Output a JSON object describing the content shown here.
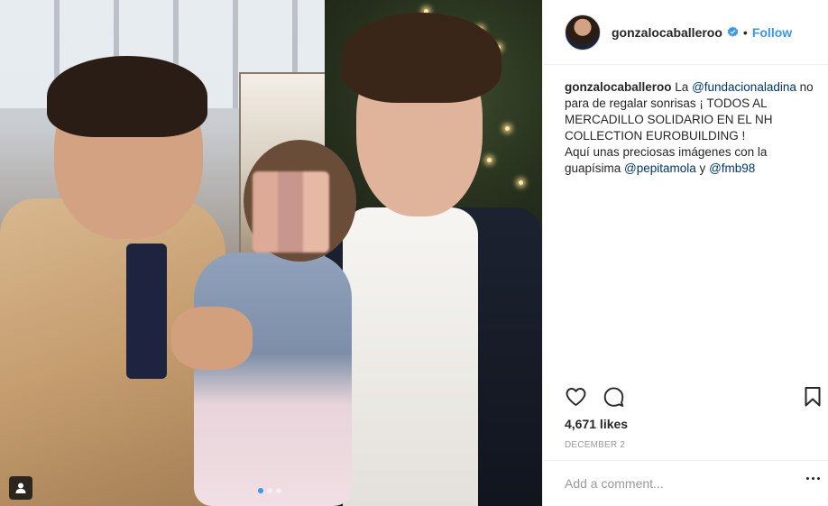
{
  "post": {
    "username": "gonzalocaballeroo",
    "follow_label": "Follow",
    "bullet": "•",
    "caption": {
      "username": "gonzalocaballeroo",
      "part1": " La ",
      "mention1": "@fundacionaladina",
      "part2": " no para de regalar sonrisas ¡ TODOS AL MERCADILLO SOLIDARIO EN EL NH COLLECTION EUROBUILDING !",
      "part3": "Aquí unas preciosas imágenes con la guapísima ",
      "mention2": "@pepitamola",
      "part4": " y ",
      "mention3": "@fmb98"
    },
    "likes": "4,671 likes",
    "date": "DECEMBER 2",
    "comment_placeholder": "Add a comment..."
  },
  "icons": {
    "verified": "verified-badge-icon",
    "like": "heart-icon",
    "comment": "comment-bubble-icon",
    "save": "bookmark-icon",
    "tagged": "tagged-user-icon",
    "more": "more-options-icon"
  },
  "carousel": {
    "total": 3,
    "active_index": 0
  },
  "colors": {
    "link": "#3897f0",
    "mention": "#003569",
    "text": "#262626",
    "muted": "#999999",
    "border": "#efefef"
  }
}
